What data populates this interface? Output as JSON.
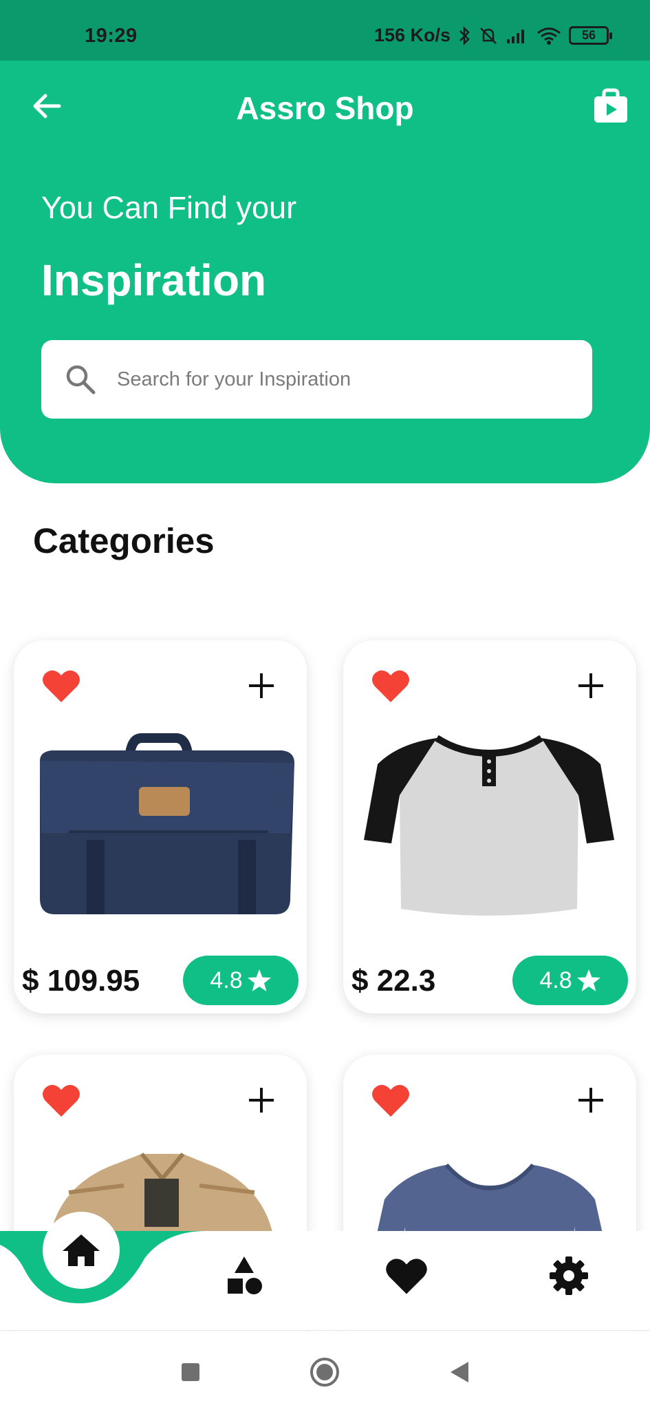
{
  "status_bar": {
    "time": "19:29",
    "network_speed": "156 Ko/s",
    "battery": "56"
  },
  "header": {
    "title": "Assro Shop",
    "back_icon": "arrow-left-icon",
    "cart_icon": "shopping-bag-icon"
  },
  "hero": {
    "line1": "You Can Find your",
    "line2": "Inspiration"
  },
  "search": {
    "placeholder": "Search for your Inspiration",
    "value": ""
  },
  "categories": {
    "title": "Categories"
  },
  "products": [
    {
      "name": "backpack",
      "price": "$ 109.95",
      "rating": "4.8"
    },
    {
      "name": "raglan-shirt",
      "price": "$ 22.3",
      "rating": "4.8"
    },
    {
      "name": "jacket",
      "price": "",
      "rating": ""
    },
    {
      "name": "t-shirt",
      "price": "",
      "rating": ""
    }
  ],
  "colors": {
    "primary": "#10bf86",
    "status_bar": "#0a9a6c",
    "favorite": "#f44336",
    "text": "#111111"
  },
  "bottom_nav": {
    "items": [
      "home-icon",
      "shapes-icon",
      "heart-icon",
      "gear-icon"
    ],
    "active": "home-icon"
  }
}
